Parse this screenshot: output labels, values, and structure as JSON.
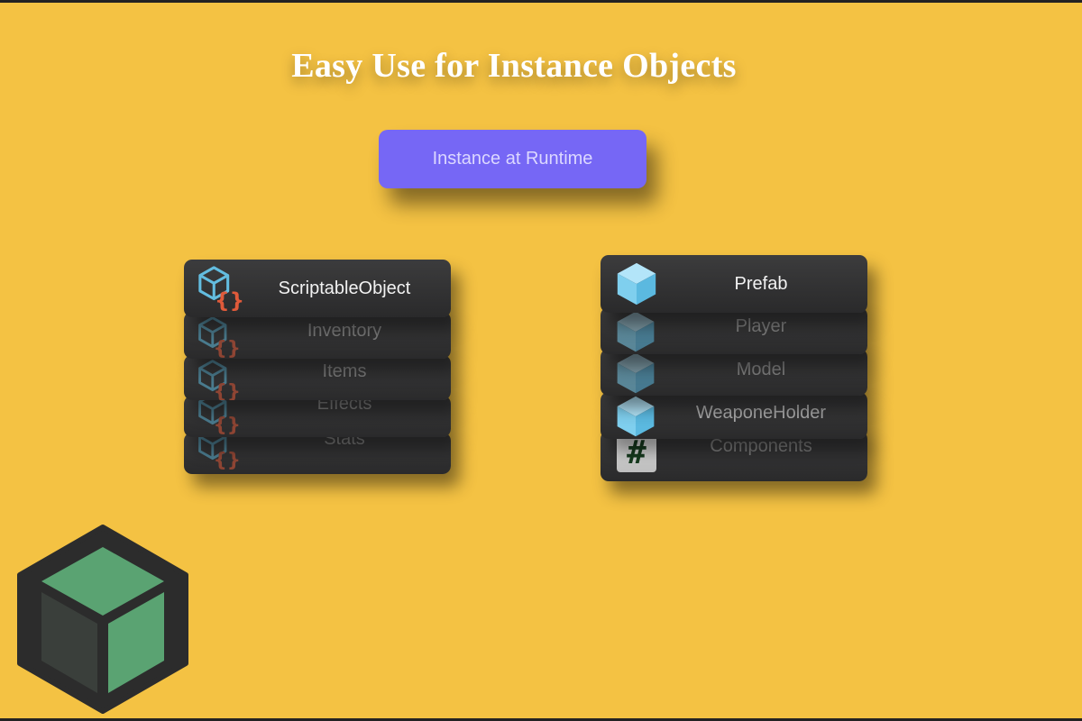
{
  "title": "Easy Use for Instance Objects",
  "runtime_button": "Instance at Runtime",
  "scriptable_stack": {
    "header": "ScriptableObject",
    "items": [
      "Inventory",
      "Items",
      "Effects",
      "Stats"
    ]
  },
  "prefab_stack": {
    "header": "Prefab",
    "items": [
      "Player",
      "Model",
      "WeaponeHolder",
      "Components"
    ]
  },
  "icons": {
    "scriptable": "scriptable-object-icon",
    "prefab": "prefab-cube-icon",
    "script": "script-hash-icon",
    "logo": "cube-logo-icon"
  },
  "colors": {
    "background": "#f4c243",
    "button": "#7667f5",
    "card": "#333334",
    "prefab_blue": "#7fcfee",
    "scriptable_blue": "#63bde0",
    "brace_orange": "#e05a3a",
    "logo_green": "#5aa372"
  }
}
